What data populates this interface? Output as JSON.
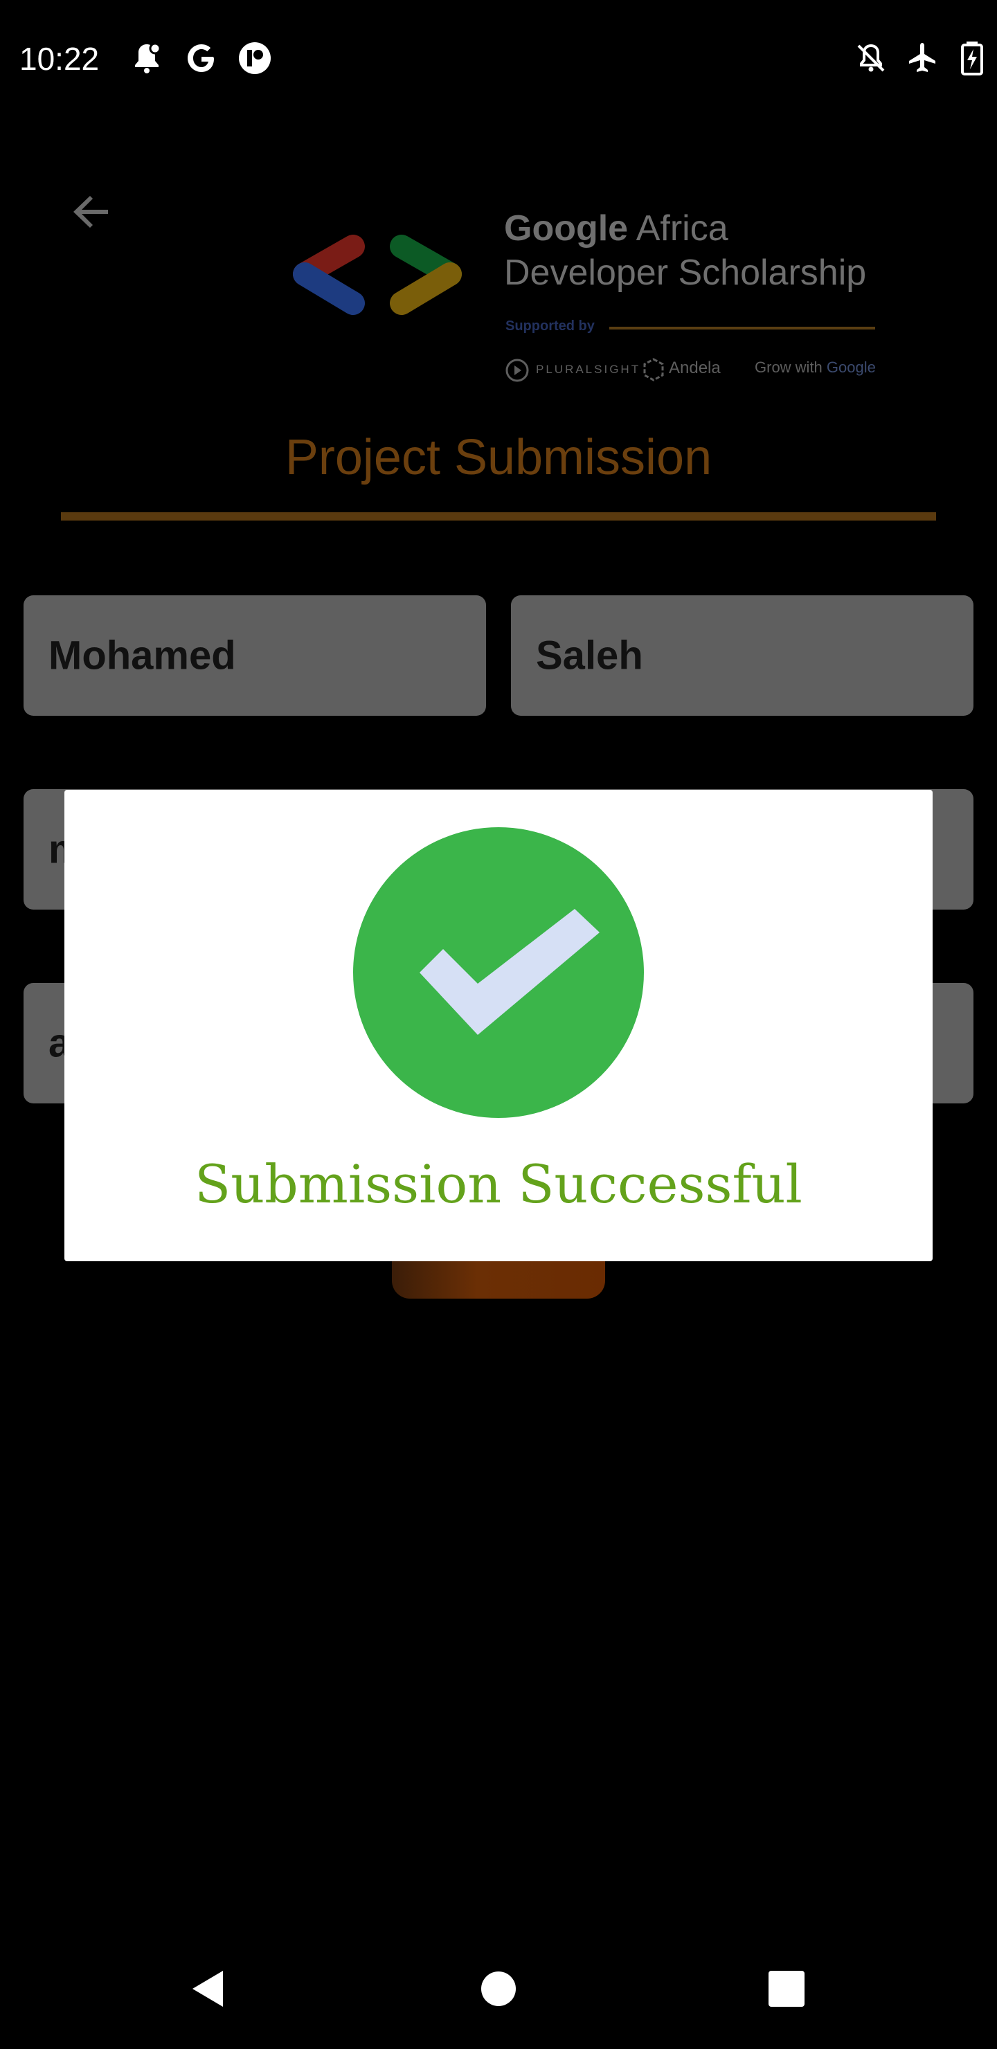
{
  "status_bar": {
    "time": "10:22",
    "icons": [
      "notification-bell-icon",
      "google-g-icon",
      "circle-app-icon",
      "bell-off-icon",
      "airplane-mode-icon",
      "battery-charging-icon"
    ]
  },
  "app": {
    "back_icon": "arrow-left-icon",
    "logo": {
      "title_bold": "Google",
      "title_rest": " Africa",
      "subtitle": "Developer Scholarship",
      "supported_by": "Supported by",
      "partners": [
        "PLURALSIGHT",
        "Andela",
        "Grow with ",
        "Google"
      ]
    },
    "page_title": "Project Submission",
    "fields": {
      "first_name": "Mohamed",
      "last_name": "Saleh",
      "email_partial": "m",
      "link_partial": "a"
    }
  },
  "dialog": {
    "icon": "check-circle-icon",
    "message": "Submission Successful"
  },
  "nav_bar": {
    "icons": [
      "back-triangle-icon",
      "home-circle-icon",
      "recents-square-icon"
    ]
  },
  "colors": {
    "title": "#6b3f0e",
    "dialog_text": "#63a21b",
    "check_green": "#3bb54a",
    "check_mark": "#d6e0f5"
  }
}
